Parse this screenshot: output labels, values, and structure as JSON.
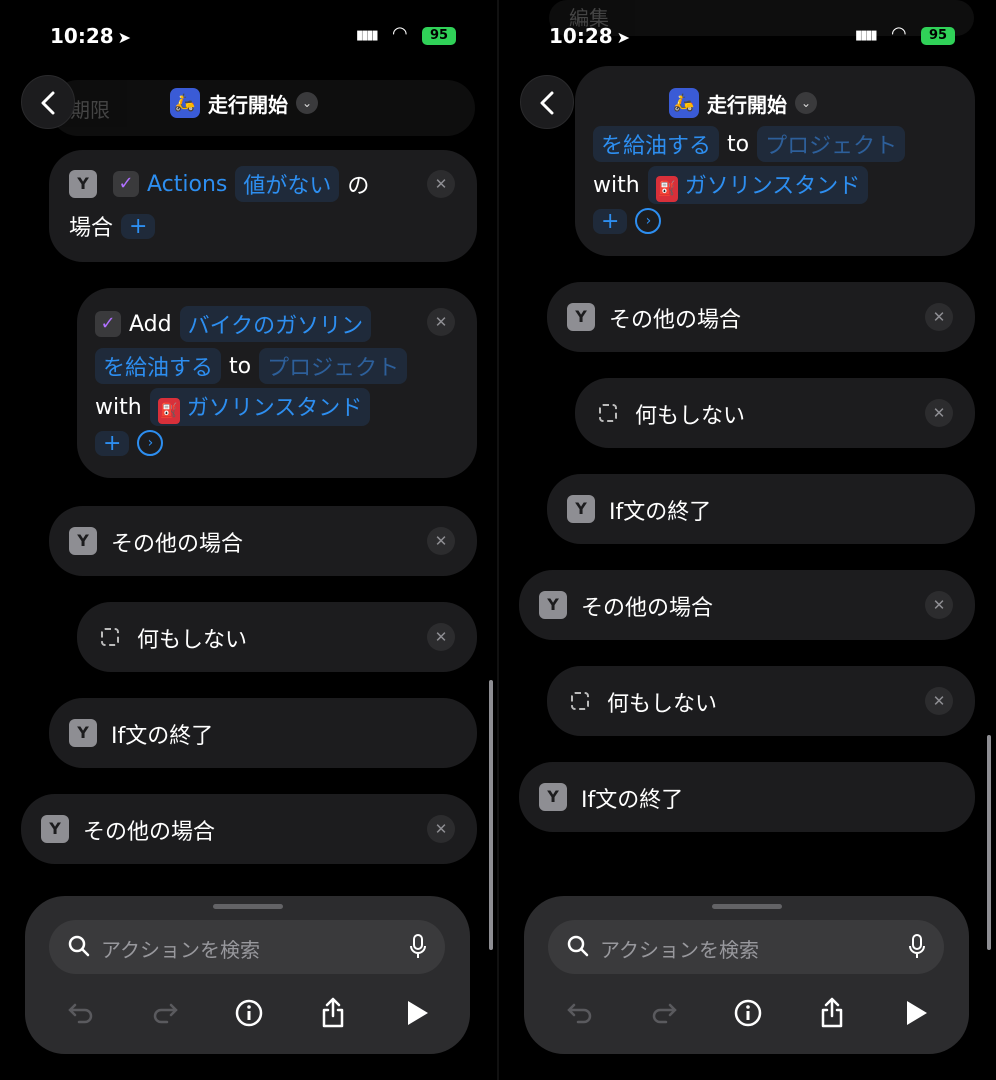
{
  "status": {
    "time": "10:28",
    "battery": "95"
  },
  "header": {
    "title": "走行開始"
  },
  "if_block": {
    "var_label": "Actions",
    "condition": "値がない",
    "particle": "の",
    "suffix": "場合"
  },
  "add_action": {
    "add_word": "Add",
    "item_line1": "バイクのガソリン",
    "item_line2": "を給油する",
    "to_word": "to",
    "project": "プロジェクト",
    "with_word": "with",
    "tag": "ガソリンスタンド"
  },
  "labels": {
    "otherwise": "その他の場合",
    "nothing": "何もしない",
    "end_if": "If文の終了"
  },
  "right_bg": {
    "top_label": "編集",
    "mid_label": "期限"
  },
  "search": {
    "placeholder": "アクションを検索"
  },
  "icons": {
    "back": "chevron-left-icon",
    "branch": "branch-icon",
    "close": "close-icon",
    "undo": "undo-icon",
    "redo": "redo-icon",
    "info": "info-icon",
    "share": "share-icon",
    "play": "play-icon"
  },
  "colors": {
    "accent": "#2d8ef0",
    "battery": "#30d158",
    "app_icon": "#3a5bd6"
  }
}
